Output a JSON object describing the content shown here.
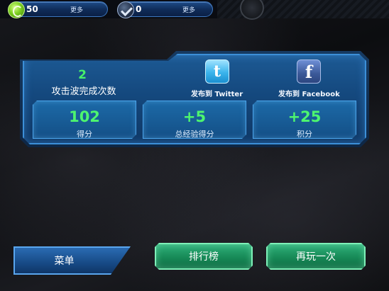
{
  "topbar": {
    "credits": {
      "icon": "green-coin-icon",
      "value": "50",
      "more_label": "更多"
    },
    "rank": {
      "icon": "rank-chevron-icon",
      "value": "0",
      "more_label": "更多"
    }
  },
  "results": {
    "waves_completed": {
      "value": "2",
      "label": "攻击波完成次数"
    },
    "share": {
      "twitter": {
        "icon": "twitter-bird-icon",
        "glyph": "t",
        "label": "发布到 Twitter"
      },
      "facebook": {
        "icon": "facebook-f-icon",
        "glyph": "f",
        "label": "发布到 Facebook"
      }
    },
    "stats": [
      {
        "value": "102",
        "label": "得分"
      },
      {
        "value": "+5",
        "label": "总经验得分"
      },
      {
        "value": "+25",
        "label": "积分"
      }
    ]
  },
  "buttons": {
    "menu": "菜单",
    "leaderboard": "排行榜",
    "play_again": "再玩一次"
  },
  "colors": {
    "panel_blue": "#154a80",
    "panel_border": "#3c8fd8",
    "stat_green": "#4df56f",
    "button_green": "#178a57"
  }
}
